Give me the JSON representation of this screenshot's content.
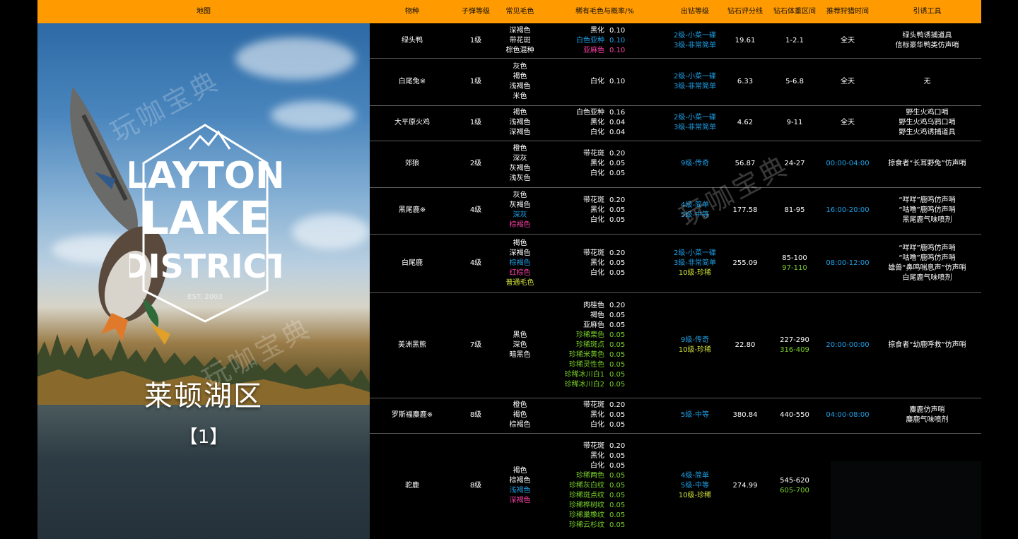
{
  "header": {
    "map": "地图",
    "species": "物种",
    "ammo_class": "子弹等级",
    "common_fur": "常见毛色",
    "rare_fur": "稀有毛色与概率/%",
    "diamond_level": "出钻等级",
    "score_line": "钻石评分线",
    "weight_range": "钻石体重区间",
    "hunt_time": "推荐狩猎时间",
    "lure": "引诱工具"
  },
  "map": {
    "logo_line1": "LAYTON",
    "logo_line2": "LAKE",
    "logo_line3": "DISTRICT",
    "logo_est": "EST. 2003",
    "title": "莱顿湖区",
    "page": "【1】"
  },
  "watermark": "玩咖宝典",
  "colors": {
    "header_bg": "#ff9a00",
    "blue": "#1fa0e6",
    "pink": "#ff3fa8",
    "green": "#79d02a",
    "yellow": "#cfe03a"
  },
  "rows": [
    {
      "height": 49,
      "species": "绿头鸭",
      "ammo": "1级",
      "common": [
        {
          "t": "深褐色",
          "c": "white"
        },
        {
          "t": "带花斑",
          "c": "white"
        },
        {
          "t": "棕色混种",
          "c": "white"
        }
      ],
      "rare": [
        {
          "n": "黑化",
          "p": "0.10",
          "c": "white"
        },
        {
          "n": "白色亚种",
          "p": "0.10",
          "c": "blue"
        },
        {
          "n": "亚麻色",
          "p": "0.10",
          "c": "pink"
        }
      ],
      "level": [
        {
          "t": "2级-小菜一碟",
          "c": "blue"
        },
        {
          "t": "3级-非常简单",
          "c": "blue"
        }
      ],
      "score": "19.61",
      "weight": [
        {
          "t": "1-2.1",
          "c": "white"
        }
      ],
      "time": {
        "t": "全天",
        "c": "white"
      },
      "lure": [
        "绿头鸭诱捕道具",
        "信标豪华鸭类仿声哨"
      ]
    },
    {
      "height": 67,
      "species": "白尾兔※",
      "ammo": "1级",
      "common": [
        {
          "t": "灰色",
          "c": "white"
        },
        {
          "t": "褐色",
          "c": "white"
        },
        {
          "t": "浅褐色",
          "c": "white"
        },
        {
          "t": "米色",
          "c": "white"
        }
      ],
      "rare": [
        {
          "n": "白化",
          "p": "0.10",
          "c": "white"
        }
      ],
      "level": [
        {
          "t": "2级-小菜一碟",
          "c": "blue"
        },
        {
          "t": "3级-非常简单",
          "c": "blue"
        }
      ],
      "score": "6.33",
      "weight": [
        {
          "t": "5-6.8",
          "c": "white"
        }
      ],
      "time": {
        "t": "全天",
        "c": "white"
      },
      "lure": [
        "无"
      ]
    },
    {
      "height": 50,
      "species": "大平原火鸡",
      "ammo": "1级",
      "common": [
        {
          "t": "褐色",
          "c": "white"
        },
        {
          "t": "浅褐色",
          "c": "white"
        },
        {
          "t": "深褐色",
          "c": "white"
        }
      ],
      "rare": [
        {
          "n": "白色亚种",
          "p": "0.16",
          "c": "white"
        },
        {
          "n": "黑化",
          "p": "0.04",
          "c": "white"
        },
        {
          "n": "白化",
          "p": "0.04",
          "c": "white"
        }
      ],
      "level": [
        {
          "t": "2级-小菜一碟",
          "c": "blue"
        },
        {
          "t": "3级-非常简单",
          "c": "blue"
        }
      ],
      "score": "4.62",
      "weight": [
        {
          "t": "9-11",
          "c": "white"
        }
      ],
      "time": {
        "t": "全天",
        "c": "white"
      },
      "lure": [
        "野生火鸡口哨",
        "野生火鸡乌鸦口哨",
        "野生火鸡诱捕道具"
      ]
    },
    {
      "height": 66,
      "species": "郊狼",
      "ammo": "2级",
      "common": [
        {
          "t": "橙色",
          "c": "white"
        },
        {
          "t": "深灰",
          "c": "white"
        },
        {
          "t": "灰褐色",
          "c": "white"
        },
        {
          "t": "浅灰色",
          "c": "white"
        }
      ],
      "rare": [
        {
          "n": "带花斑",
          "p": "0.20",
          "c": "white"
        },
        {
          "n": "黑化",
          "p": "0.05",
          "c": "white"
        },
        {
          "n": "白化",
          "p": "0.05",
          "c": "white"
        }
      ],
      "level": [
        {
          "t": "9级-传奇",
          "c": "blue"
        }
      ],
      "score": "56.87",
      "weight": [
        {
          "t": "24-27",
          "c": "white"
        }
      ],
      "time": {
        "t": "00:00-04:00",
        "c": "blue"
      },
      "lure": [
        "掠食者“长耳野兔”仿声哨"
      ]
    },
    {
      "height": 66,
      "species": "黑尾鹿※",
      "ammo": "4级",
      "common": [
        {
          "t": "灰色",
          "c": "white"
        },
        {
          "t": "灰褐色",
          "c": "white"
        },
        {
          "t": "深灰",
          "c": "blue"
        },
        {
          "t": "棕褐色",
          "c": "pink"
        }
      ],
      "rare": [
        {
          "n": "带花斑",
          "p": "0.20",
          "c": "white"
        },
        {
          "n": "黑化",
          "p": "0.05",
          "c": "white"
        },
        {
          "n": "白化",
          "p": "0.05",
          "c": "white"
        }
      ],
      "level": [
        {
          "t": "4级-简单",
          "c": "blue"
        },
        {
          "t": "5级-中等",
          "c": "blue"
        }
      ],
      "score": "177.58",
      "weight": [
        {
          "t": "81-95",
          "c": "white"
        }
      ],
      "time": {
        "t": "16:00-20:00",
        "c": "blue"
      },
      "lure": [
        "“咩咩”鹿鸣仿声哨",
        "“咕噜”鹿鸣仿声哨",
        "黑尾鹿气味喷剂"
      ]
    },
    {
      "height": 83,
      "species": "白尾鹿",
      "ammo": "4级",
      "common": [
        {
          "t": "褐色",
          "c": "white"
        },
        {
          "t": "深褐色",
          "c": "white"
        },
        {
          "t": "棕褐色",
          "c": "blue"
        },
        {
          "t": "红棕色",
          "c": "pink"
        },
        {
          "t": "普通毛色",
          "c": "yellow"
        }
      ],
      "rare": [
        {
          "n": "带花斑",
          "p": "0.20",
          "c": "white"
        },
        {
          "n": "黑化",
          "p": "0.05",
          "c": "white"
        },
        {
          "n": "白化",
          "p": "0.05",
          "c": "white"
        }
      ],
      "level": [
        {
          "t": "2级-小菜一碟",
          "c": "blue"
        },
        {
          "t": "3级-非常简单",
          "c": "blue"
        },
        {
          "t": "10级-珍稀",
          "c": "yellow"
        }
      ],
      "score": "255.09",
      "weight": [
        {
          "t": "85-100",
          "c": "white"
        },
        {
          "t": "97-110",
          "c": "green"
        }
      ],
      "time": {
        "t": "08:00-12:00",
        "c": "blue"
      },
      "lure": [
        "“咩咩”鹿鸣仿声哨",
        "“咕噜”鹿鸣仿声哨",
        "雄兽“鼻鸣喘息声”仿声哨",
        "白尾鹿气味喷剂"
      ]
    },
    {
      "height": 149,
      "species": "美洲黑熊",
      "ammo": "7级",
      "common": [
        {
          "t": "黑色",
          "c": "white"
        },
        {
          "t": "深色",
          "c": "white"
        },
        {
          "t": "暗黑色",
          "c": "white"
        }
      ],
      "rare": [
        {
          "n": "肉桂色",
          "p": "0.20",
          "c": "white"
        },
        {
          "n": "褐色",
          "p": "0.05",
          "c": "white"
        },
        {
          "n": "亚麻色",
          "p": "0.05",
          "c": "white"
        },
        {
          "n": "珍稀栗色",
          "p": "0.05",
          "c": "green"
        },
        {
          "n": "珍稀斑点",
          "p": "0.05",
          "c": "green"
        },
        {
          "n": "珍稀米黄色",
          "p": "0.05",
          "c": "green"
        },
        {
          "n": "珍稀灵性色",
          "p": "0.05",
          "c": "green"
        },
        {
          "n": "珍稀冰川白1",
          "p": "0.05",
          "c": "green"
        },
        {
          "n": "珍稀冰川白2",
          "p": "0.05",
          "c": "green"
        }
      ],
      "level": [
        {
          "t": "9级-传奇",
          "c": "blue"
        },
        {
          "t": "10级-珍稀",
          "c": "yellow"
        }
      ],
      "score": "22.80",
      "weight": [
        {
          "t": "227-290",
          "c": "white"
        },
        {
          "t": "316-409",
          "c": "green"
        }
      ],
      "time": {
        "t": "20:00-00:00",
        "c": "blue"
      },
      "lure": [
        "掠食者“幼鹿呼救”仿声哨"
      ]
    },
    {
      "height": 50,
      "species": "罗斯福麋鹿※",
      "ammo": "8级",
      "common": [
        {
          "t": "橙色",
          "c": "white"
        },
        {
          "t": "褐色",
          "c": "white"
        },
        {
          "t": "棕褐色",
          "c": "white"
        }
      ],
      "rare": [
        {
          "n": "带花斑",
          "p": "0.20",
          "c": "white"
        },
        {
          "n": "黑化",
          "p": "0.05",
          "c": "white"
        },
        {
          "n": "白化",
          "p": "0.05",
          "c": "white"
        }
      ],
      "level": [
        {
          "t": "5级-中等",
          "c": "blue"
        }
      ],
      "score": "380.84",
      "weight": [
        {
          "t": "440-550",
          "c": "white"
        }
      ],
      "time": {
        "t": "04:00-08:00",
        "c": "blue"
      },
      "lure": [
        "麋鹿仿声哨",
        "麋鹿气味喷剂"
      ]
    },
    {
      "height": 150,
      "species": "驼鹿",
      "ammo": "8级",
      "common": [
        {
          "t": "褐色",
          "c": "white"
        },
        {
          "t": "棕褐色",
          "c": "white"
        },
        {
          "t": "浅褐色",
          "c": "blue"
        },
        {
          "t": "深褐色",
          "c": "pink"
        }
      ],
      "rare": [
        {
          "n": "带花斑",
          "p": "0.20",
          "c": "white"
        },
        {
          "n": "黑化",
          "p": "0.05",
          "c": "white"
        },
        {
          "n": "白化",
          "p": "0.05",
          "c": "white"
        },
        {
          "n": "珍稀两色",
          "p": "0.05",
          "c": "green"
        },
        {
          "n": "珍稀灰白纹",
          "p": "0.05",
          "c": "green"
        },
        {
          "n": "珍稀斑点纹",
          "p": "0.05",
          "c": "green"
        },
        {
          "n": "珍稀桦树纹",
          "p": "0.05",
          "c": "green"
        },
        {
          "n": "珍稀巢橡纹",
          "p": "0.05",
          "c": "green"
        },
        {
          "n": "珍稀云杉纹",
          "p": "0.05",
          "c": "green"
        }
      ],
      "level": [
        {
          "t": "4级-简单",
          "c": "blue"
        },
        {
          "t": "5级-中等",
          "c": "blue"
        },
        {
          "t": "10级-珍稀",
          "c": "yellow"
        }
      ],
      "score": "274.99",
      "weight": [
        {
          "t": "545-620",
          "c": "white"
        },
        {
          "t": "605-700",
          "c": "green"
        }
      ],
      "time": {
        "t": "",
        "c": "blue"
      },
      "lure": []
    }
  ]
}
